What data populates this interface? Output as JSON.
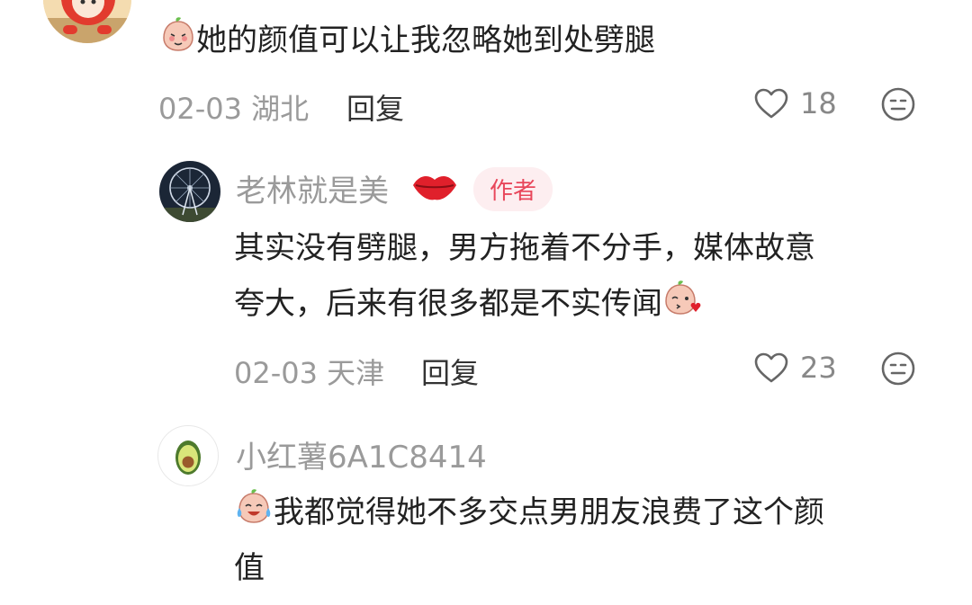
{
  "comments": [
    {
      "text": "她的颜值可以让我忽略她到处劈腿",
      "date": "02-03",
      "location": "湖北",
      "reply_label": "回复",
      "likes": "18"
    },
    {
      "username": "老林就是美",
      "badge": "作者",
      "text_line1": "其实没有劈腿，男方拖着不分手，媒体故意",
      "text_line2": "夸大，后来有很多都是不实传闻",
      "date": "02-03",
      "location": "天津",
      "reply_label": "回复",
      "likes": "23"
    },
    {
      "username": "小红薯6A1C8414",
      "text_line1": "我都觉得她不多交点男朋友浪费了这个颜",
      "text_line2": "值"
    }
  ],
  "icons": {
    "like": "heart-outline-icon",
    "react": "neutral-face-icon",
    "lips": "kiss-lips-icon"
  },
  "colors": {
    "badge_text": "#e8475b",
    "badge_bg": "#fdeef0",
    "meta": "#9a9a9a"
  }
}
